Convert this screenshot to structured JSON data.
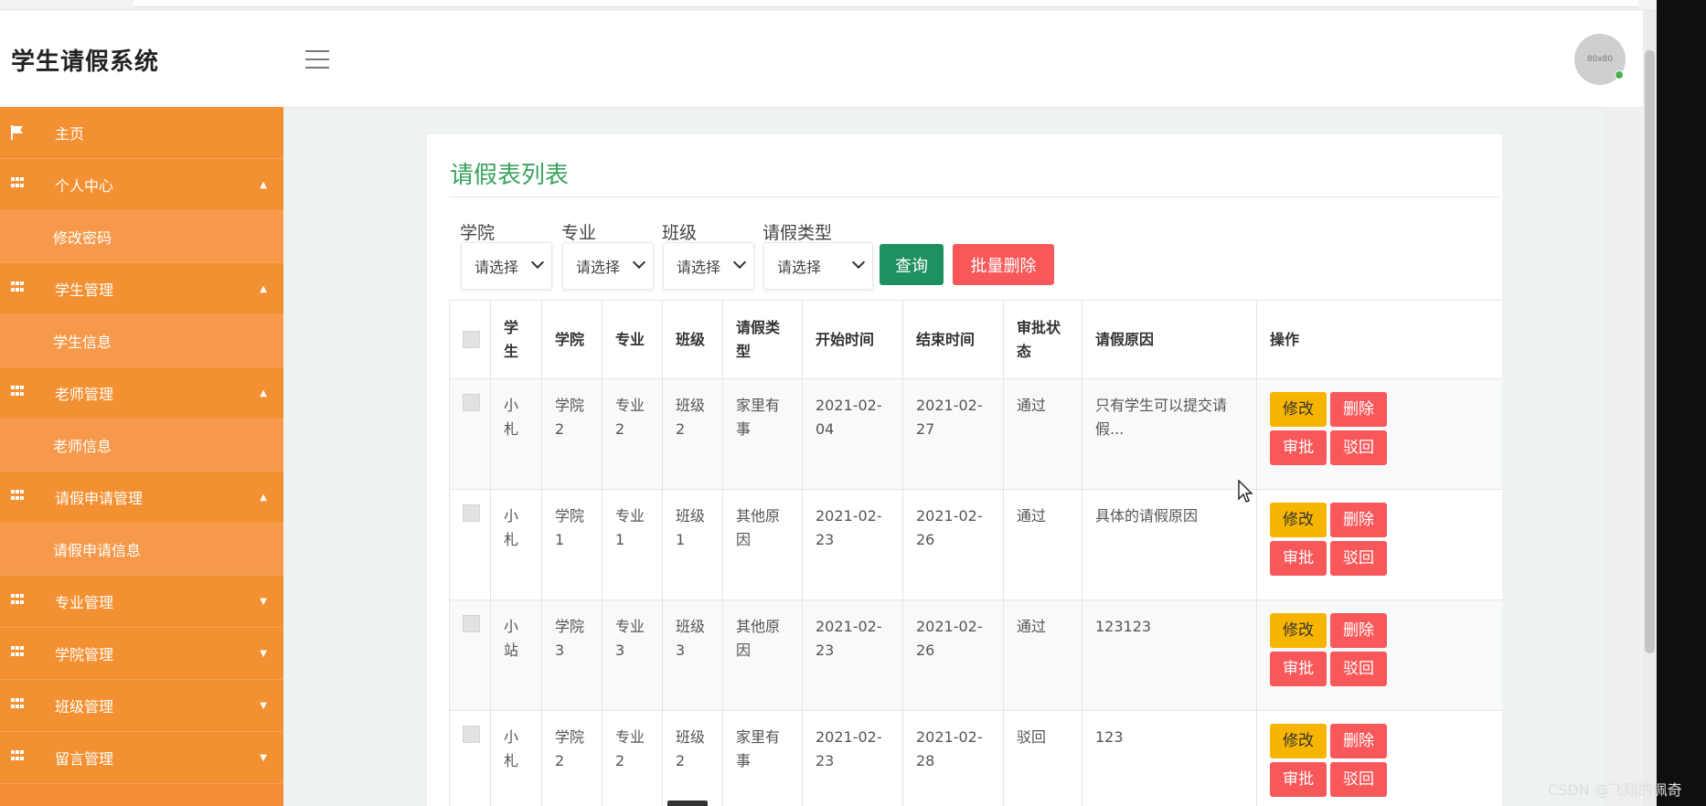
{
  "header": {
    "app_title": "学生请假系统",
    "avatar_text": "80x80"
  },
  "sidebar": {
    "items": [
      {
        "label": "主页",
        "icon": "flag-icon",
        "level": "top"
      },
      {
        "label": "个人中心",
        "icon": "grid-icon",
        "level": "top",
        "arrow": "up"
      },
      {
        "label": "修改密码",
        "level": "sub"
      },
      {
        "label": "学生管理",
        "icon": "grid-icon",
        "level": "top",
        "arrow": "up"
      },
      {
        "label": "学生信息",
        "level": "sub"
      },
      {
        "label": "老师管理",
        "icon": "grid-icon",
        "level": "top",
        "arrow": "up"
      },
      {
        "label": "老师信息",
        "level": "sub"
      },
      {
        "label": "请假申请管理",
        "icon": "grid-icon",
        "level": "top",
        "arrow": "up"
      },
      {
        "label": "请假申请信息",
        "level": "sub"
      },
      {
        "label": "专业管理",
        "icon": "grid-icon",
        "level": "top",
        "arrow": "down"
      },
      {
        "label": "学院管理",
        "icon": "grid-icon",
        "level": "top",
        "arrow": "down"
      },
      {
        "label": "班级管理",
        "icon": "grid-icon",
        "level": "top",
        "arrow": "down"
      },
      {
        "label": "留言管理",
        "icon": "grid-icon",
        "level": "top",
        "arrow": "down"
      }
    ]
  },
  "main": {
    "page_title": "请假表列表",
    "filters": [
      {
        "label": "学院",
        "value": "请选择"
      },
      {
        "label": "专业",
        "value": "请选择"
      },
      {
        "label": "班级",
        "value": "请选择"
      },
      {
        "label": "请假类型",
        "value": "请选择"
      }
    ],
    "query_button": "查询",
    "batch_delete_button": "批量删除",
    "table": {
      "headers": [
        "学生",
        "学院",
        "专业",
        "班级",
        "请假类型",
        "开始时间",
        "结束时间",
        "审批状态",
        "请假原因",
        "操作"
      ],
      "rows": [
        {
          "student": "小札",
          "college": "学院2",
          "major": "专业2",
          "class": "班级2",
          "type": "家里有事",
          "start": "2021-02-04",
          "end": "2021-02-27",
          "status": "通过",
          "reason": "只有学生可以提交请假..."
        },
        {
          "student": "小札",
          "college": "学院1",
          "major": "专业1",
          "class": "班级1",
          "type": "其他原因",
          "start": "2021-02-23",
          "end": "2021-02-26",
          "status": "通过",
          "reason": "具体的请假原因"
        },
        {
          "student": "小站",
          "college": "学院3",
          "major": "专业3",
          "class": "班级3",
          "type": "其他原因",
          "start": "2021-02-23",
          "end": "2021-02-26",
          "status": "通过",
          "reason": "123123"
        },
        {
          "student": "小札",
          "college": "学院2",
          "major": "专业2",
          "class": "班级2",
          "type": "家里有事",
          "start": "2021-02-23",
          "end": "2021-02-28",
          "status": "驳回",
          "reason": "123"
        }
      ],
      "row_actions": {
        "edit": "修改",
        "delete": "删除",
        "approve": "审批",
        "reject": "驳回"
      }
    }
  },
  "watermark": "CSDN @飞翔的佩奇",
  "colors": {
    "sidebar": "#f48c37",
    "title_green": "#3aa35d",
    "query_green": "#1f9060",
    "danger_red": "#f8585a",
    "warning_yellow": "#f7b500"
  }
}
